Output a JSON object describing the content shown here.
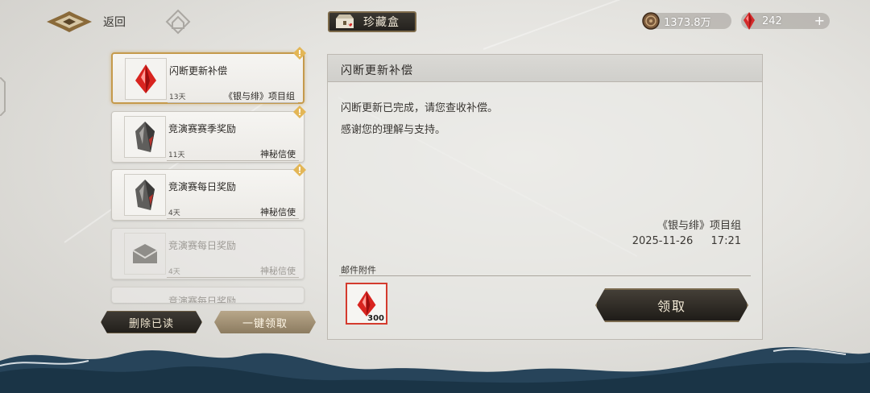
{
  "header": {
    "back_label": "返回",
    "title": "珍藏盒",
    "currencies": [
      {
        "icon": "coin-icon",
        "value": "1373.8万"
      },
      {
        "icon": "red-crystal-icon",
        "value": "242",
        "plus": "+"
      }
    ]
  },
  "mail_list": [
    {
      "subject": "闪断更新补偿",
      "days": "13天",
      "sender": "《银与绯》项目组",
      "icon": "red-crystal-icon",
      "state": "selected",
      "new": true
    },
    {
      "subject": "竞演赛赛季奖励",
      "days": "11天",
      "sender": "神秘信使",
      "icon": "gray-crystal-icon",
      "state": "unread",
      "new": true
    },
    {
      "subject": "竞演赛每日奖励",
      "days": "4天",
      "sender": "神秘信使",
      "icon": "gray-crystal-icon",
      "state": "unread",
      "new": true
    },
    {
      "subject": "竞演赛每日奖励",
      "days": "4天",
      "sender": "神秘信使",
      "icon": "envelope-icon",
      "state": "read",
      "new": false
    },
    {
      "subject": "竞演赛每日奖励",
      "state": "read-partial"
    }
  ],
  "actions": {
    "delete_read": "删除已读",
    "claim_all": "一键领取"
  },
  "detail": {
    "title": "闪断更新补偿",
    "body": [
      "闪断更新已完成，请您查收补偿。",
      "感谢您的理解与支持。"
    ],
    "signature": "《银与绯》项目组",
    "date": "2025-11-26",
    "time": "17:21",
    "attachments_label": "邮件附件",
    "attachments": [
      {
        "icon": "red-crystal-icon",
        "count": "300"
      }
    ],
    "claim_label": "领取"
  },
  "colors": {
    "accent_gold": "#c59a4c",
    "crystal_red": "#d42a2a",
    "dark_button": "#2e2a25"
  }
}
